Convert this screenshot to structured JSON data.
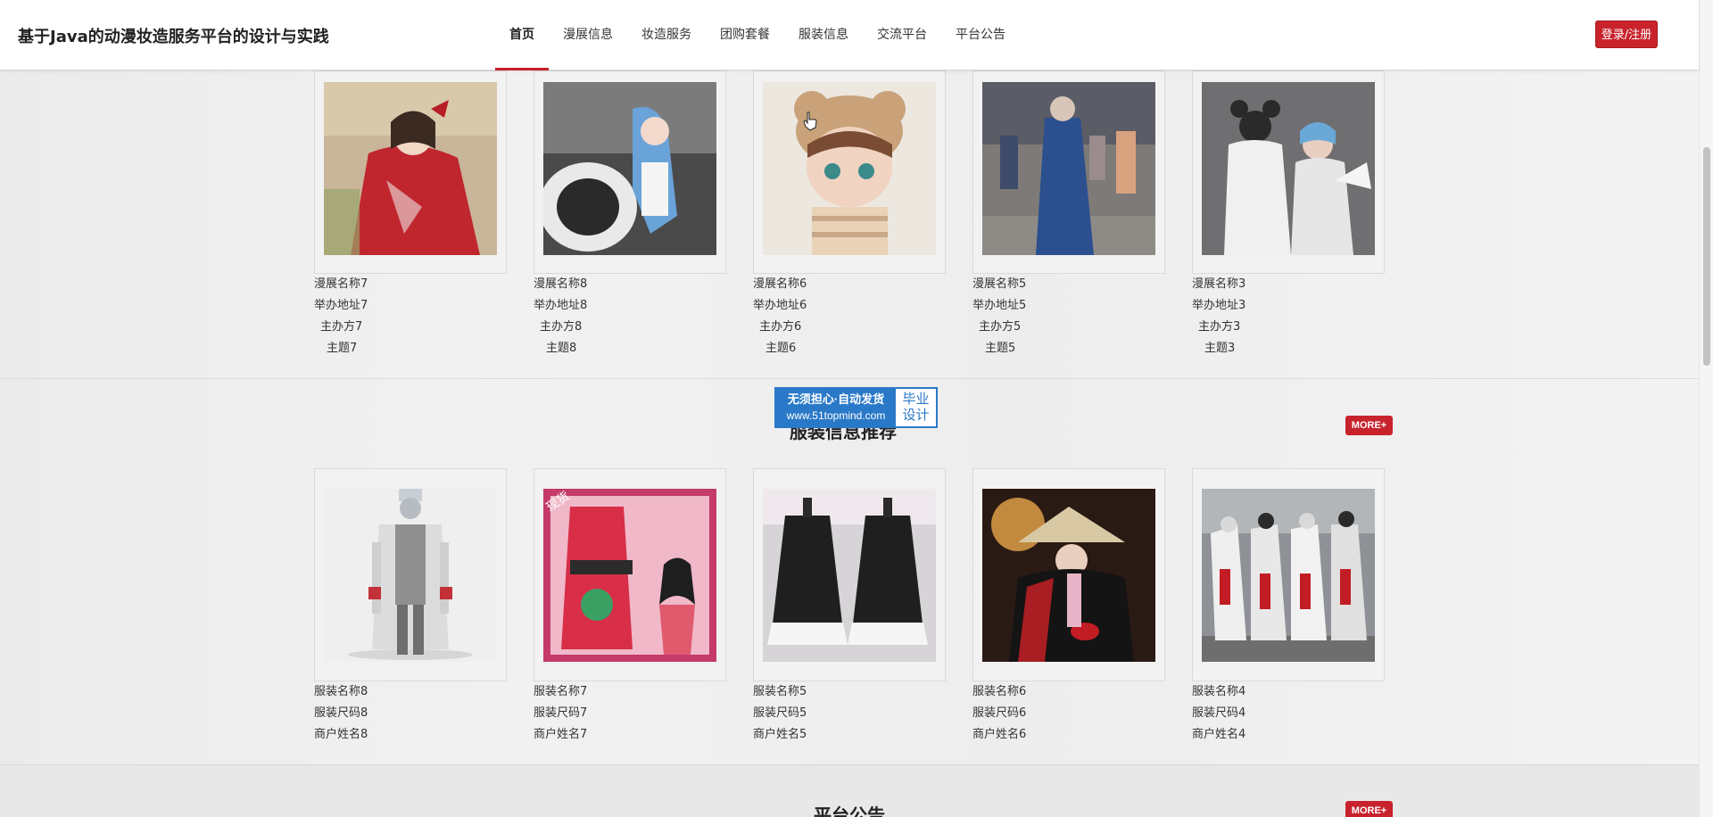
{
  "header": {
    "title": "基于Java的动漫妆造服务平台的设计与实践",
    "nav": [
      "首页",
      "漫展信息",
      "妆造服务",
      "团购套餐",
      "服装信息",
      "交流平台",
      "平台公告"
    ],
    "active_nav": "首页",
    "login_label": "登录/注册"
  },
  "exhibitions": {
    "cards": [
      {
        "name": "漫展名称7",
        "address": "举办地址7",
        "organizer": "主办方7",
        "theme": "主题7"
      },
      {
        "name": "漫展名称8",
        "address": "举办地址8",
        "organizer": "主办方8",
        "theme": "主题8"
      },
      {
        "name": "漫展名称6",
        "address": "举办地址6",
        "organizer": "主办方6",
        "theme": "主题6"
      },
      {
        "name": "漫展名称5",
        "address": "举办地址5",
        "organizer": "主办方5",
        "theme": "主题5"
      },
      {
        "name": "漫展名称3",
        "address": "举办地址3",
        "organizer": "主办方3",
        "theme": "主题3"
      }
    ]
  },
  "clothing": {
    "title": "服装信息推荐",
    "more_label": "MORE+",
    "cards": [
      {
        "name": "服装名称8",
        "size": "服装尺码8",
        "merchant": "商户姓名8"
      },
      {
        "name": "服装名称7",
        "size": "服装尺码7",
        "merchant": "商户姓名7",
        "badge": "现货"
      },
      {
        "name": "服装名称5",
        "size": "服装尺码5",
        "merchant": "商户姓名5"
      },
      {
        "name": "服装名称6",
        "size": "服装尺码6",
        "merchant": "商户姓名6"
      },
      {
        "name": "服装名称4",
        "size": "服装尺码4",
        "merchant": "商户姓名4"
      }
    ]
  },
  "announcements": {
    "title": "平台公告",
    "more_label": "MORE+"
  },
  "watermark": {
    "line1": "无须担心·自动发货",
    "line2": "www.51topmind.com",
    "right1": "毕业",
    "right2": "设计"
  },
  "colors": {
    "accent": "#c8232c",
    "watermark_blue": "#2a79c8"
  }
}
